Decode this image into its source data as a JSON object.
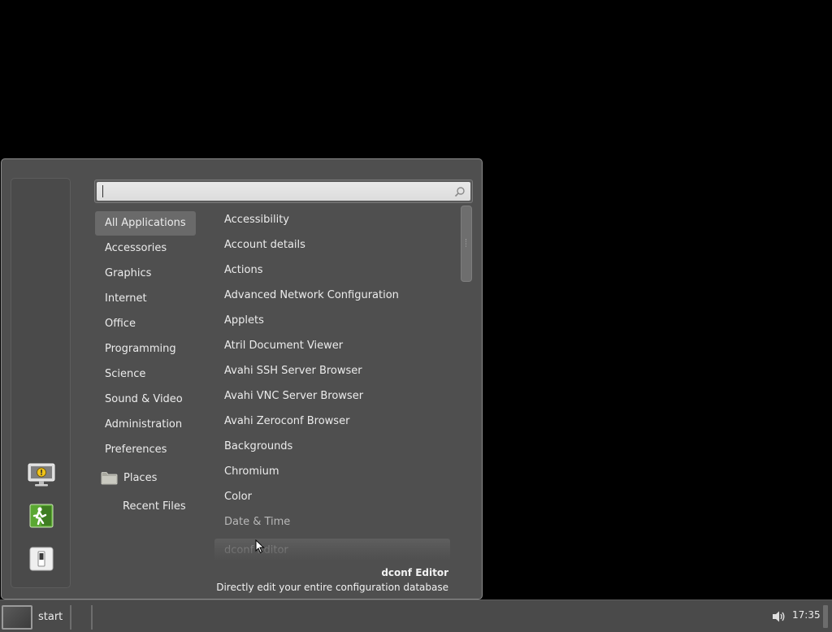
{
  "search": {
    "value": "",
    "placeholder": ""
  },
  "favorites": [
    {
      "icon": "screensaver-lock-icon"
    },
    {
      "icon": "logout-icon"
    },
    {
      "icon": "shutdown-icon"
    }
  ],
  "categories": [
    {
      "label": "All Applications",
      "selected": true
    },
    {
      "label": "Accessories"
    },
    {
      "label": "Graphics"
    },
    {
      "label": "Internet"
    },
    {
      "label": "Office"
    },
    {
      "label": "Programming"
    },
    {
      "label": "Science"
    },
    {
      "label": "Sound & Video"
    },
    {
      "label": "Administration"
    },
    {
      "label": "Preferences"
    }
  ],
  "places": {
    "label": "Places",
    "icon": "folder-icon"
  },
  "recent_files": {
    "label": "Recent Files"
  },
  "applications": [
    {
      "label": "Accessibility"
    },
    {
      "label": "Account details"
    },
    {
      "label": "Actions"
    },
    {
      "label": "Advanced Network Configuration"
    },
    {
      "label": "Applets"
    },
    {
      "label": "Atril Document Viewer"
    },
    {
      "label": "Avahi SSH Server Browser"
    },
    {
      "label": "Avahi VNC Server Browser"
    },
    {
      "label": "Avahi Zeroconf Browser"
    },
    {
      "label": "Backgrounds"
    },
    {
      "label": "Chromium"
    },
    {
      "label": "Color"
    },
    {
      "label": "Date & Time"
    },
    {
      "label": "dconf Editor"
    }
  ],
  "description": {
    "title": "dconf Editor",
    "text": "Directly edit your entire configuration database"
  },
  "taskbar": {
    "start_label": "start",
    "clock": "17:35",
    "volume_icon": "volume-icon"
  },
  "colors": {
    "menu_bg": "#4f4f4f",
    "taskbar_bg": "#4a4a4a",
    "desktop_bg": "#000000",
    "logout_green": "#5aa832"
  }
}
